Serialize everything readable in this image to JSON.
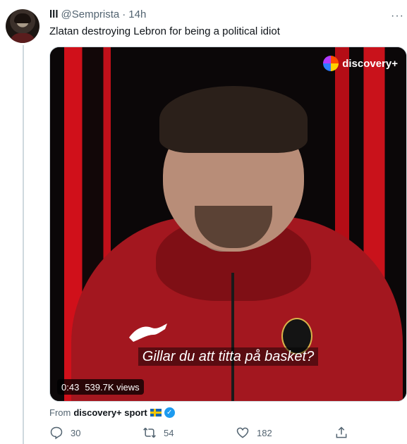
{
  "tweet": {
    "name": "lll",
    "handle": "@Semprista",
    "separator": "·",
    "time": "14h",
    "more": "···",
    "text": "Zlatan destroying Lebron for being a political idiot"
  },
  "media": {
    "brand": "discovery+",
    "subtitle": "Gillar du att titta på basket?",
    "duration": "0:43",
    "views": "539.7K views",
    "colors": {
      "stripes": "#d0101a",
      "hoodie": "#a3171f"
    }
  },
  "source": {
    "prefix": "From",
    "name": "discovery+ sport",
    "verified_icon": "check-icon",
    "flag_icon": "swedish-flag-icon"
  },
  "actions": {
    "replies": "30",
    "retweets": "54",
    "likes": "182"
  }
}
